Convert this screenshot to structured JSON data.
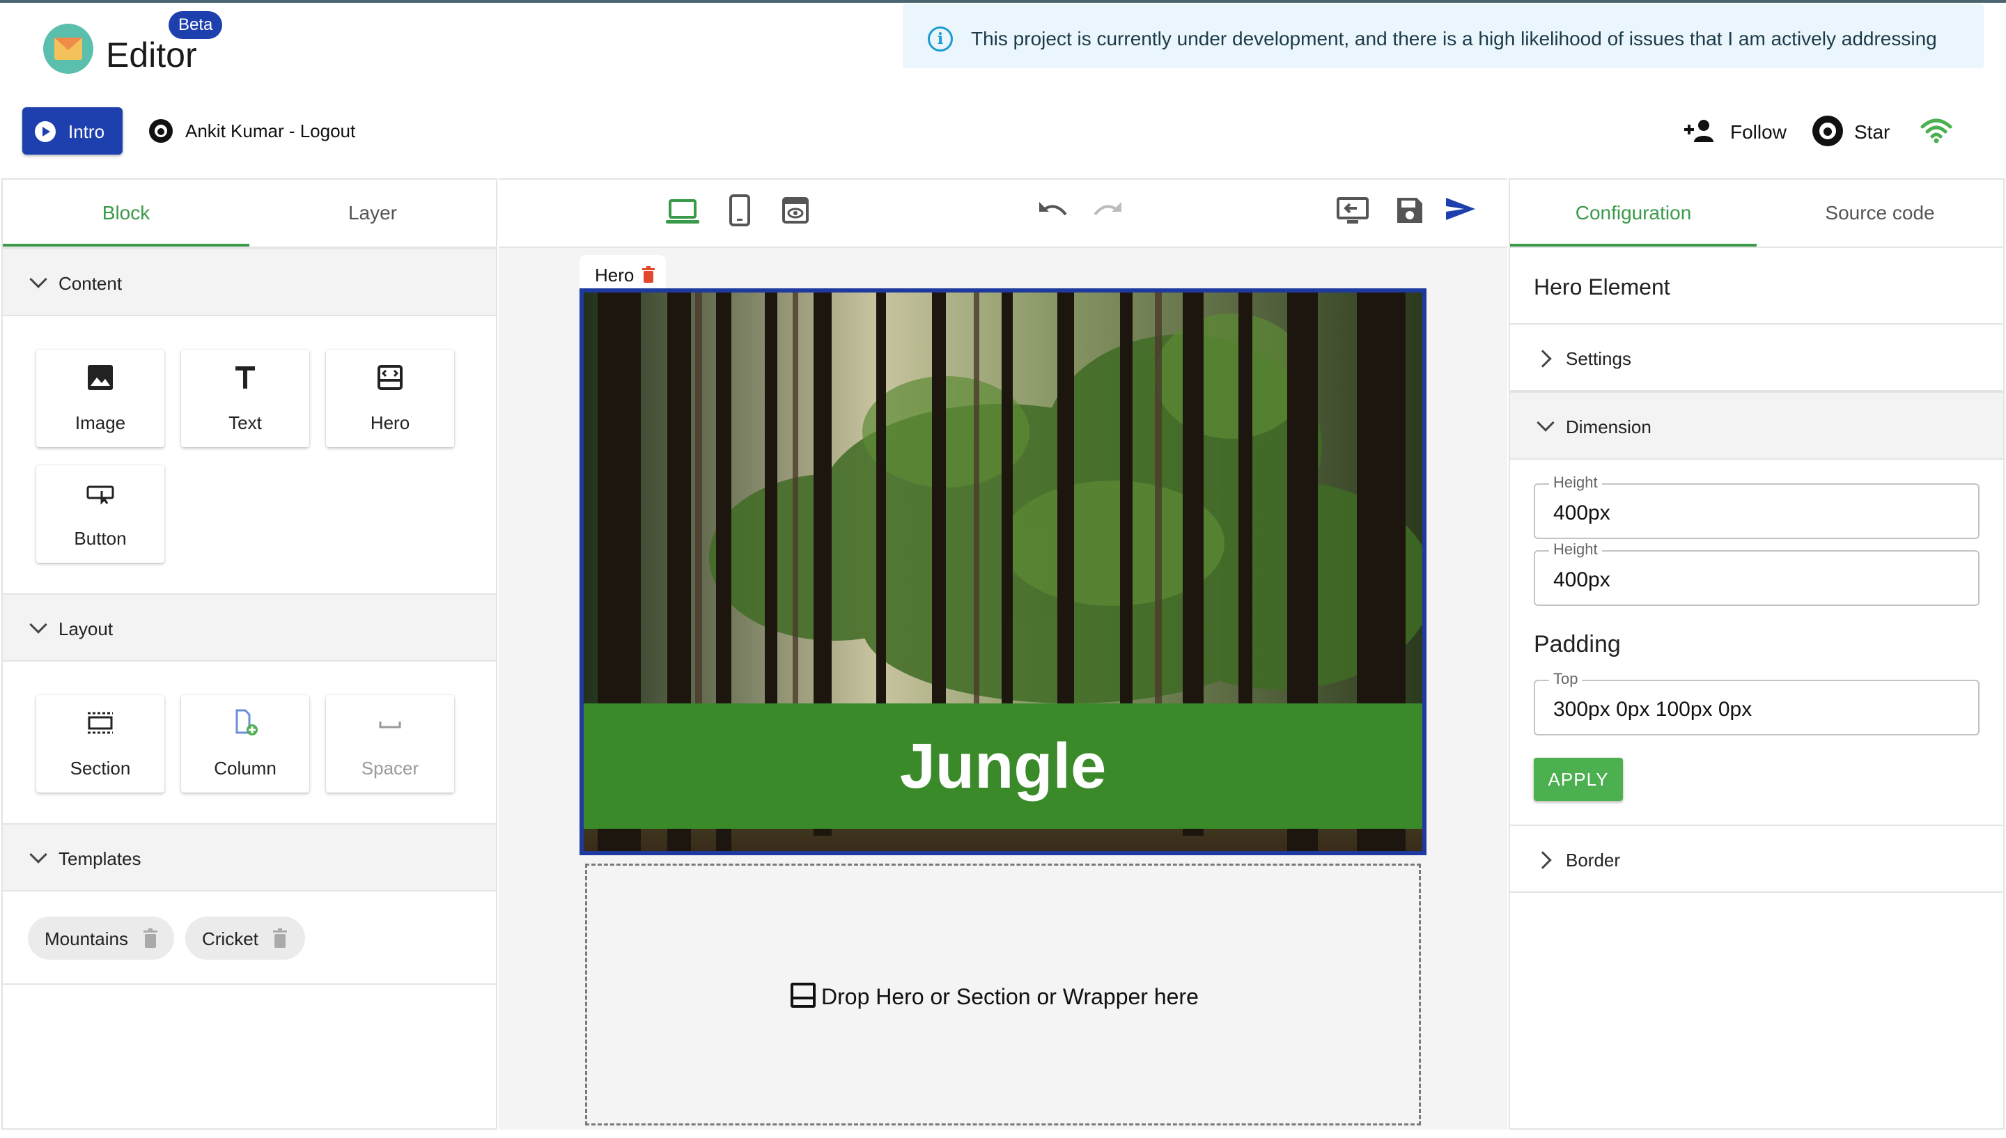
{
  "header": {
    "app_title": "Editor",
    "beta_badge": "Beta",
    "alert_text": "This project is currently under development, and there is a high likelihood of issues that I am actively addressing",
    "intro_label": "Intro",
    "user_text": "Ankit Kumar - Logout",
    "follow_label": "Follow",
    "star_label": "Star"
  },
  "left_panel": {
    "tabs": [
      {
        "label": "Block",
        "active": true
      },
      {
        "label": "Layer",
        "active": false
      }
    ],
    "content_section": {
      "label": "Content",
      "items": [
        {
          "label": "Image",
          "icon": "image-icon"
        },
        {
          "label": "Text",
          "icon": "text-icon"
        },
        {
          "label": "Hero",
          "icon": "hero-icon"
        },
        {
          "label": "Button",
          "icon": "button-icon"
        }
      ]
    },
    "layout_section": {
      "label": "Layout",
      "items": [
        {
          "label": "Section",
          "icon": "section-icon"
        },
        {
          "label": "Column",
          "icon": "column-icon"
        },
        {
          "label": "Spacer",
          "icon": "spacer-icon",
          "disabled": true
        }
      ]
    },
    "templates_section": {
      "label": "Templates",
      "items": [
        {
          "label": "Mountains"
        },
        {
          "label": "Cricket"
        }
      ]
    }
  },
  "canvas": {
    "selected_tag": "Hero",
    "hero_title": "Jungle",
    "drop_text": "Drop Hero or Section or Wrapper here"
  },
  "right_panel": {
    "tabs": [
      {
        "label": "Configuration",
        "active": true
      },
      {
        "label": "Source code",
        "active": false
      }
    ],
    "element_title": "Hero Element",
    "settings_label": "Settings",
    "dimension_label": "Dimension",
    "height_fields": [
      {
        "legend": "Height",
        "value": "400px"
      },
      {
        "legend": "Height",
        "value": "400px"
      }
    ],
    "padding_title": "Padding",
    "padding_field": {
      "legend": "Top",
      "value": "300px 0px 100px 0px"
    },
    "apply_label": "APPLY",
    "border_label": "Border"
  },
  "colors": {
    "accent_green": "#3a9a4a",
    "primary_blue": "#1e40af",
    "hero_band": "#3a8a2a",
    "selection_border": "#1e3a9f"
  }
}
